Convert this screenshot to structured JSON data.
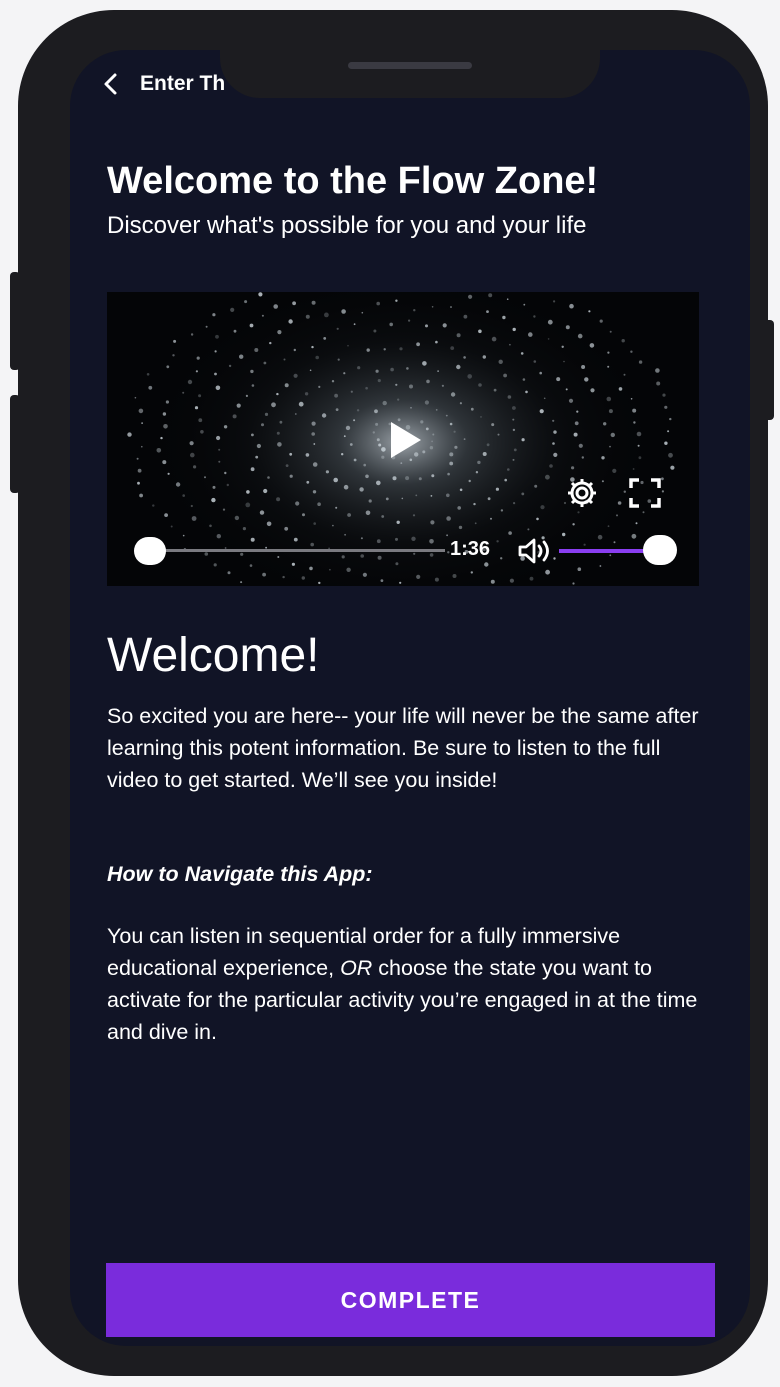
{
  "nav": {
    "back_icon": "chevron-left-icon",
    "title": "Enter Th"
  },
  "header": {
    "title": "Welcome to the Flow Zone!",
    "subtitle": "Discover what's possible for you and your life"
  },
  "video": {
    "current_time": "1:36",
    "progress": 0.0,
    "volume": 1.0,
    "icons": [
      "play-icon",
      "settings-gear-icon",
      "fullscreen-icon",
      "volume-icon"
    ],
    "accent_color": "#8a3ef0"
  },
  "content": {
    "heading": "Welcome!",
    "paragraph1": "So excited you are here-- your life will never be the same after learning this potent information. Be sure to listen to the full video to get started. We’ll see you inside!",
    "nav_heading": "How to Navigate this App:",
    "paragraph2_before": "You can listen in sequential order for a fully immersive educational experience, ",
    "paragraph2_or": "OR",
    "paragraph2_after": " choose the state you want to activate for the particular activity you’re engaged in at the time and dive in."
  },
  "footer": {
    "complete_label": "COMPLETE",
    "button_color": "#7a2cdc"
  },
  "colors": {
    "background": "#111426",
    "frame": "#1c1c20"
  }
}
